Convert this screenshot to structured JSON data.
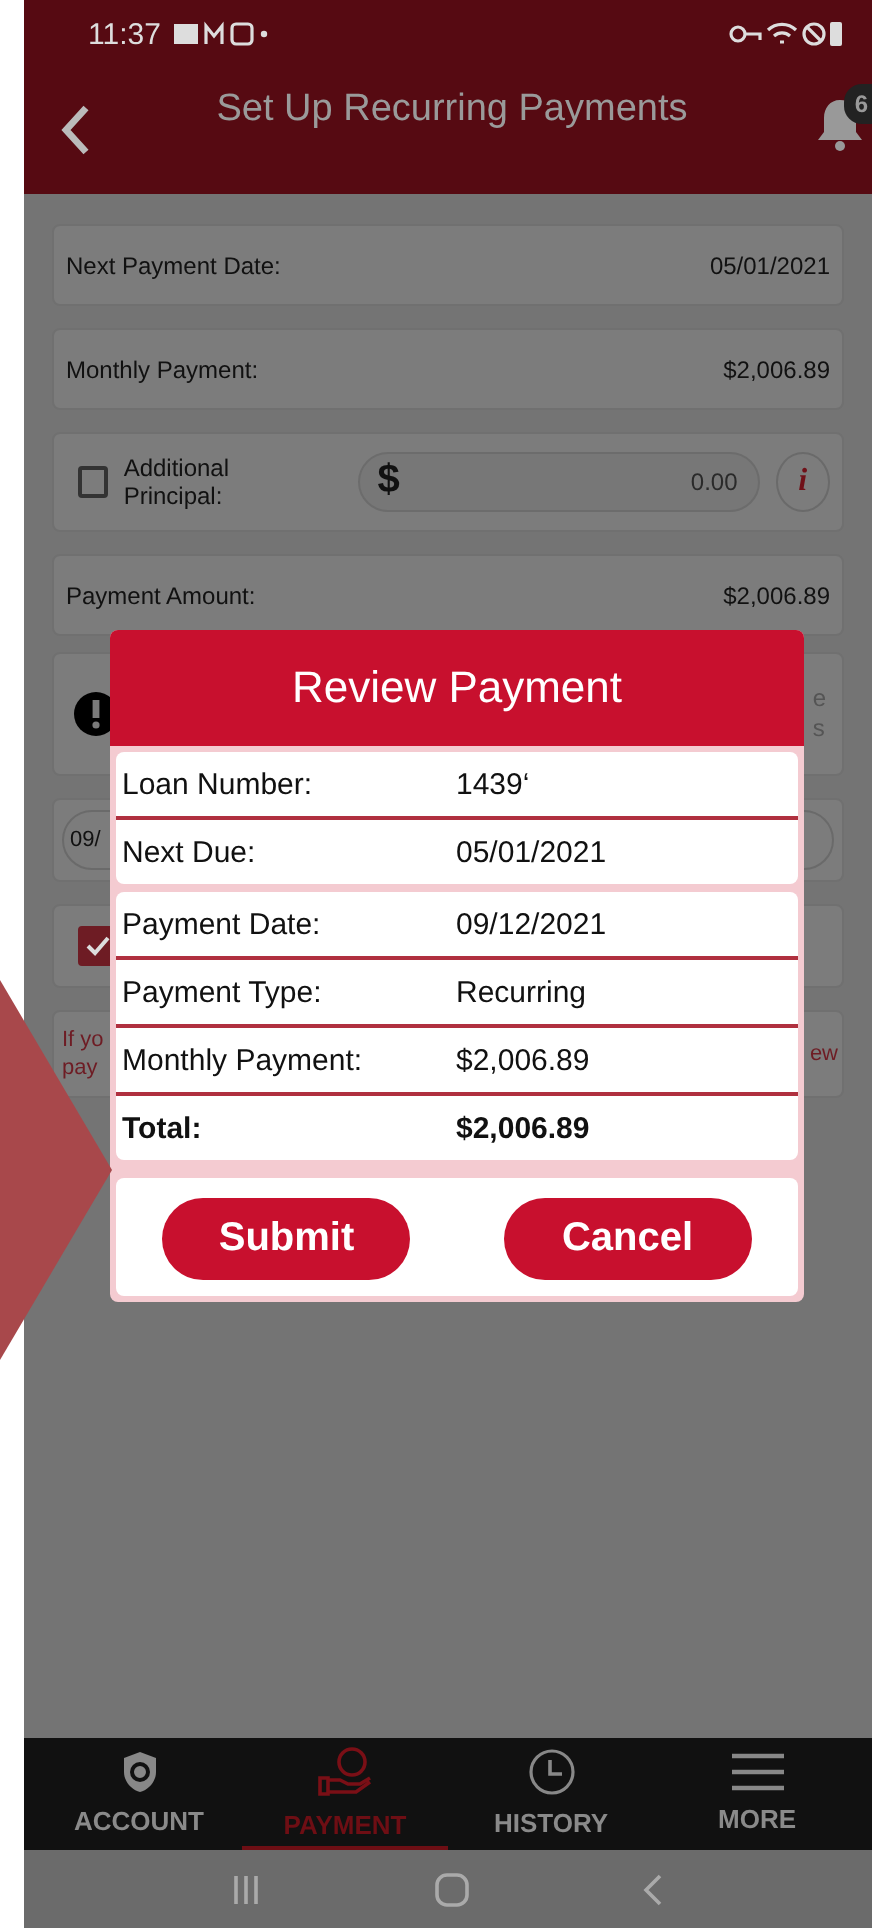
{
  "status_bar": {
    "time": "11:37"
  },
  "header": {
    "title": "Set Up Recurring Payments",
    "notification_count": "6"
  },
  "fields": [
    {
      "kind": "row",
      "label": "Next Payment Date:",
      "value": "05/01/2021"
    },
    {
      "kind": "row",
      "label": "Monthly Payment:",
      "value": "$2,006.89"
    },
    {
      "kind": "input",
      "label": "Additional Principal:",
      "checked": false,
      "currency": "$",
      "placeholder": "0.00",
      "info_label": "i"
    },
    {
      "kind": "row",
      "label": "Payment Amount:",
      "value": "$2,006.89"
    }
  ],
  "covered": {
    "warning_fragments": [
      "e",
      "s"
    ],
    "date_fragment": "09/",
    "autopay_checked": true,
    "note_fragments_left": [
      "If yo",
      "pay"
    ],
    "note_fragment_right": "ew"
  },
  "dialog": {
    "title": "Review Payment",
    "groups": [
      [
        {
          "label": "Loan Number:",
          "value": "1439‘",
          "bold": false
        },
        {
          "label": "Next Due:",
          "value": "05/01/2021",
          "bold": false
        }
      ],
      [
        {
          "label": "Payment Date:",
          "value": "09/12/2021",
          "bold": false
        },
        {
          "label": "Payment Type:",
          "value": "Recurring",
          "bold": false
        },
        {
          "label": "Monthly Payment:",
          "value": "$2,006.89",
          "bold": false
        },
        {
          "label": "Total:",
          "value": "$2,006.89",
          "bold": true
        }
      ]
    ],
    "buttons": [
      "Submit",
      "Cancel"
    ]
  },
  "tabs": [
    {
      "label": "ACCOUNT",
      "selected": false
    },
    {
      "label": "PAYMENT",
      "selected": true
    },
    {
      "label": "HISTORY",
      "selected": false
    },
    {
      "label": "MORE",
      "selected": false
    }
  ]
}
